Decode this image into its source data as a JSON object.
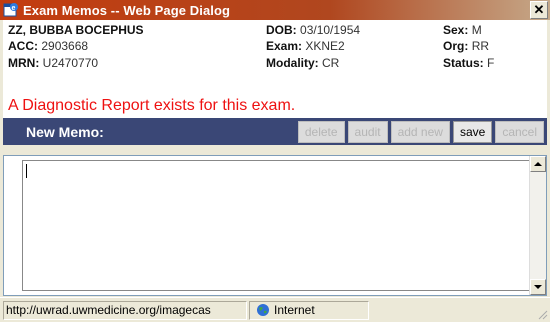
{
  "window": {
    "title": "Exam Memos -- Web Page Dialog",
    "close_glyph": "✕"
  },
  "patient": {
    "name": "ZZ, BUBBA BOCEPHUS",
    "acc_label": "ACC:",
    "acc_value": "2903668",
    "mrn_label": "MRN:",
    "mrn_value": "U2470770",
    "dob_label": "DOB:",
    "dob_value": "03/10/1954",
    "exam_label": "Exam:",
    "exam_value": "XKNE2",
    "modality_label": "Modality:",
    "modality_value": "CR",
    "sex_label": "Sex:",
    "sex_value": "M",
    "org_label": "Org:",
    "org_value": "RR",
    "status_label": "Status:",
    "status_value": "F"
  },
  "banner": {
    "text": "A Diagnostic Report exists for this exam.",
    "color": "#ee1111"
  },
  "memo_bar": {
    "title": "New Memo:",
    "buttons": {
      "delete": "delete",
      "audit": "audit",
      "add_new": "add new",
      "save": "save",
      "cancel": "cancel"
    },
    "color": "#3a4776"
  },
  "memo": {
    "value": ""
  },
  "statusbar": {
    "url": "http://uwrad.uwmedicine.org/imagecas",
    "zone": "Internet",
    "zone_icon": "globe-icon"
  },
  "icons": {
    "title_icon": "ie-dialog-icon",
    "grip": "resize-grip-icon"
  }
}
